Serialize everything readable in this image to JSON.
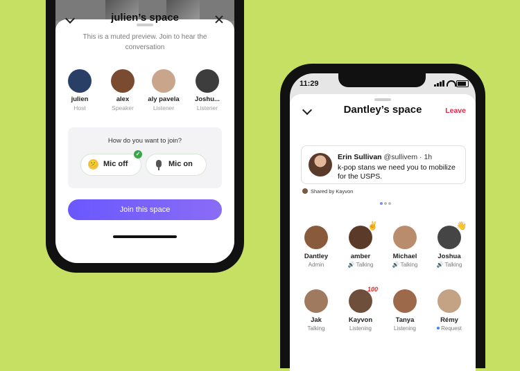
{
  "left_phone": {
    "title": "julien’s space",
    "subtitle": "This is a muted preview. Join to hear the conversation",
    "participants": [
      {
        "name": "julien",
        "role": "Host",
        "color": "#2a3f66"
      },
      {
        "name": "alex",
        "role": "Speaker",
        "color": "#7a4b30"
      },
      {
        "name": "aly pavela",
        "role": "Listener",
        "color": "#c9a58c"
      },
      {
        "name": "Joshu...",
        "role": "Listener",
        "color": "#3d3d3d"
      }
    ],
    "join_question": "How do you want to join?",
    "mic_off_label": "Mic off",
    "mic_on_label": "Mic on",
    "mic_off_emoji": "😕",
    "selected_check": "✓",
    "join_button": "Join this space"
  },
  "right_phone": {
    "status_time": "11:29",
    "title": "Dantley’s space",
    "leave_label": "Leave",
    "tweet": {
      "author": "Erin Sullivan",
      "handle": "@sullivem · 1h",
      "text": "k-pop stans we need you to mobilize for the USPS."
    },
    "shared_by": "Shared by Kayvon",
    "speakers": [
      {
        "name": "Dantley",
        "status": "Admin",
        "color": "#8a5a3c",
        "badge": ""
      },
      {
        "name": "amber",
        "status": "Talking",
        "color": "#5b3a2a",
        "badge": "✌"
      },
      {
        "name": "Michael",
        "status": "Talking",
        "color": "#b98c6e",
        "badge": ""
      },
      {
        "name": "Joshua",
        "status": "Talking",
        "color": "#454545",
        "badge": "👋"
      },
      {
        "name": "Jak",
        "status": "Talking",
        "color": "#a07a5e",
        "badge": ""
      },
      {
        "name": "Kayvon",
        "status": "Listening",
        "color": "#6e4f3c",
        "badge": "100"
      },
      {
        "name": "Tanya",
        "status": "Listening",
        "color": "#9c6a4a",
        "badge": ""
      },
      {
        "name": "Rémy",
        "status": "Request",
        "color": "#c4a284",
        "badge": ""
      }
    ],
    "talking_glyph": "🔊"
  }
}
